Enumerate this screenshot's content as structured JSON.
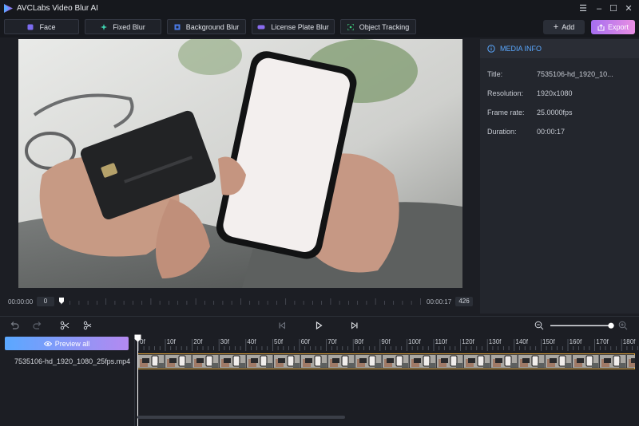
{
  "app": {
    "title": "AVCLabs Video Blur AI"
  },
  "window_controls": {
    "menu": "☰",
    "minimize": "–",
    "maximize": "☐",
    "close": "✕"
  },
  "toolbar": {
    "tools": [
      {
        "label": "Face",
        "icon": "face-icon"
      },
      {
        "label": "Fixed Blur",
        "icon": "fixed-blur-icon"
      },
      {
        "label": "Background Blur",
        "icon": "background-blur-icon"
      },
      {
        "label": "License Plate Blur",
        "icon": "license-plate-icon"
      },
      {
        "label": "Object Tracking",
        "icon": "object-tracking-icon"
      }
    ],
    "add_label": "Add",
    "export_label": "Export"
  },
  "player": {
    "time_start": "00:00:00",
    "frame_start": "0",
    "time_end": "00:00:17",
    "frame_end": "426"
  },
  "media_info": {
    "title": "MEDIA INFO",
    "rows": [
      {
        "label": "Title:",
        "value": "7535106-hd_1920_10..."
      },
      {
        "label": "Resolution:",
        "value": "1920x1080"
      },
      {
        "label": "Frame rate:",
        "value": "25.0000fps"
      },
      {
        "label": "Duration:",
        "value": "00:00:17"
      }
    ]
  },
  "timeline": {
    "preview_all_label": "Preview all",
    "clip_name": "7535106-hd_1920_1080_25fps.mp4",
    "ruler_labels": [
      "0f",
      "10f",
      "20f",
      "30f",
      "40f",
      "50f",
      "60f",
      "70f",
      "80f",
      "90f",
      "100f",
      "110f",
      "120f",
      "130f",
      "140f",
      "150f",
      "160f",
      "170f",
      "180f"
    ],
    "zoom_level": 0.95
  },
  "colors": {
    "accent": "#5aa8ff",
    "export_start": "#a56ef0",
    "export_end": "#ea8fe3",
    "clip_border": "#e2a63a"
  }
}
